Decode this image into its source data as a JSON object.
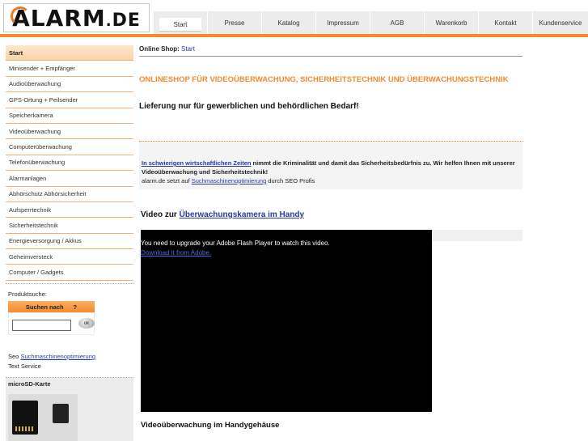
{
  "logo": {
    "brand": "ALARM",
    "dot": ".",
    "suffix": "DE"
  },
  "topnav": [
    {
      "label": "Start",
      "active": true
    },
    {
      "label": "Presse"
    },
    {
      "label": "Katalog"
    },
    {
      "label": "Impressum"
    },
    {
      "label": "AGB"
    },
    {
      "label": "Warenkorb"
    },
    {
      "label": "Kontakt"
    },
    {
      "label": "Kundenservice"
    }
  ],
  "sidebar": {
    "items": [
      "Start",
      "Minisender + Empfänger",
      "Audioüberwachung",
      "GPS-Ortung + Peilsender",
      "Speicherkamera",
      "Videoüberwachung",
      "Computerüberwachung",
      "Telefonüberwachung",
      "Alarmanlagen",
      "Abhörschutz Abhörsicherheit",
      "Aufsperrtechnik",
      "Sicherheitstechnik",
      "Energieversorgung / Akkus",
      "Geheimversteck",
      "Computer / Gadgets"
    ]
  },
  "search": {
    "label": "Produktsuche:",
    "button_label": "Suchen nach",
    "help": "?",
    "ok": "ok",
    "placeholder": ""
  },
  "seo": {
    "prefix": "Seo",
    "link": "Suchmaschinenoptimierung",
    "text": "Text Service"
  },
  "micro": {
    "title": "microSD-Karte"
  },
  "main": {
    "breadcrumb_label": "Online Shop:",
    "breadcrumb_link": "Start",
    "headline": "ONLINESHOP FÜR VIDEOÜBERWACHUNG, SICHERHEITSTECHNIK UND ÜBERWACHUNGSTECHNIK",
    "subheadline": "Lieferung nur für gewerblichen und behördlichen Bedarf!",
    "info_link": "In schwierigen wirtschaftlichen Zeiten",
    "info_text": " nimmt die Kriminalität und damit das Sicherheitsbedürfnis zu. Wir helfen Ihnen mit unserer Videoüberwachung und Sicherheitstechnik!",
    "info2_prefix": "alarm.de setzt auf ",
    "info2_link": "Suchmaschinenoptimierung",
    "info2_suffix": " durch SEO Profis",
    "video_prefix": "Video zur ",
    "video_link": "Überwachungskamera im Handy",
    "player_msg": "You need to upgrade your Adobe Flash Player to watch this video.",
    "player_link": "Download it from Adobe.",
    "bottom_title": "Videoüberwachung im Handygehäuse"
  }
}
